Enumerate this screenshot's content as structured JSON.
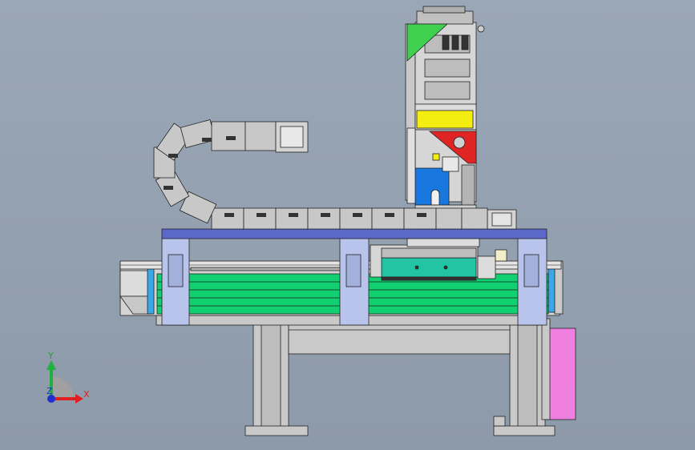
{
  "viewport": {
    "kind": "cad-assembly-front-view",
    "background_top": "#9aa7b6",
    "background_bottom": "#8d9aaa"
  },
  "triad": {
    "x_label": "X",
    "y_label": "Y",
    "z_label": "Z",
    "x_color": "#e02020",
    "y_color": "#20b040",
    "z_color": "#2030d0"
  },
  "palette": {
    "frame_gray": "#c9c9c9",
    "beam_blue": "#5b67c9",
    "rail_green": "#10d070",
    "block_teal": "#22c4a4",
    "pink_box": "#f080e0",
    "light_blue_plate": "#b8c4ec",
    "yellow_plate": "#f4ee10",
    "red_bracket": "#e02424",
    "blue_bracket": "#1878e0",
    "green_triangle": "#40d050",
    "chain_gray": "#c8c8c8"
  }
}
